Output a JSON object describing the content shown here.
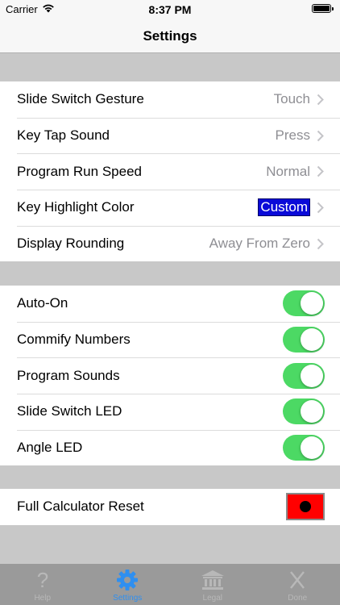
{
  "status_bar": {
    "carrier": "Carrier",
    "time": "8:37 PM"
  },
  "nav": {
    "title": "Settings"
  },
  "general": [
    {
      "label": "Slide Switch Gesture",
      "value": "Touch",
      "selected": false
    },
    {
      "label": "Key Tap Sound",
      "value": "Press",
      "selected": false
    },
    {
      "label": "Program Run Speed",
      "value": "Normal",
      "selected": false
    },
    {
      "label": "Key Highlight Color",
      "value": "Custom",
      "selected": true
    },
    {
      "label": "Display Rounding",
      "value": "Away From Zero",
      "selected": false
    }
  ],
  "toggles": [
    {
      "label": "Auto-On",
      "on": true
    },
    {
      "label": "Commify Numbers",
      "on": true
    },
    {
      "label": "Program Sounds",
      "on": true
    },
    {
      "label": "Slide Switch LED",
      "on": true
    },
    {
      "label": "Angle LED",
      "on": true
    }
  ],
  "reset": {
    "label": "Full Calculator Reset"
  },
  "tabs": [
    {
      "label": "Help",
      "icon": "question-icon",
      "active": false
    },
    {
      "label": "Settings",
      "icon": "gear-icon",
      "active": true
    },
    {
      "label": "Legal",
      "icon": "bank-icon",
      "active": false
    },
    {
      "label": "Done",
      "icon": "x-icon",
      "active": false
    }
  ],
  "colors": {
    "toggle_on": "#4cd964",
    "tab_active": "#2f8ff0",
    "highlight": "#0a0ad8",
    "reset_button": "#ff0000"
  }
}
